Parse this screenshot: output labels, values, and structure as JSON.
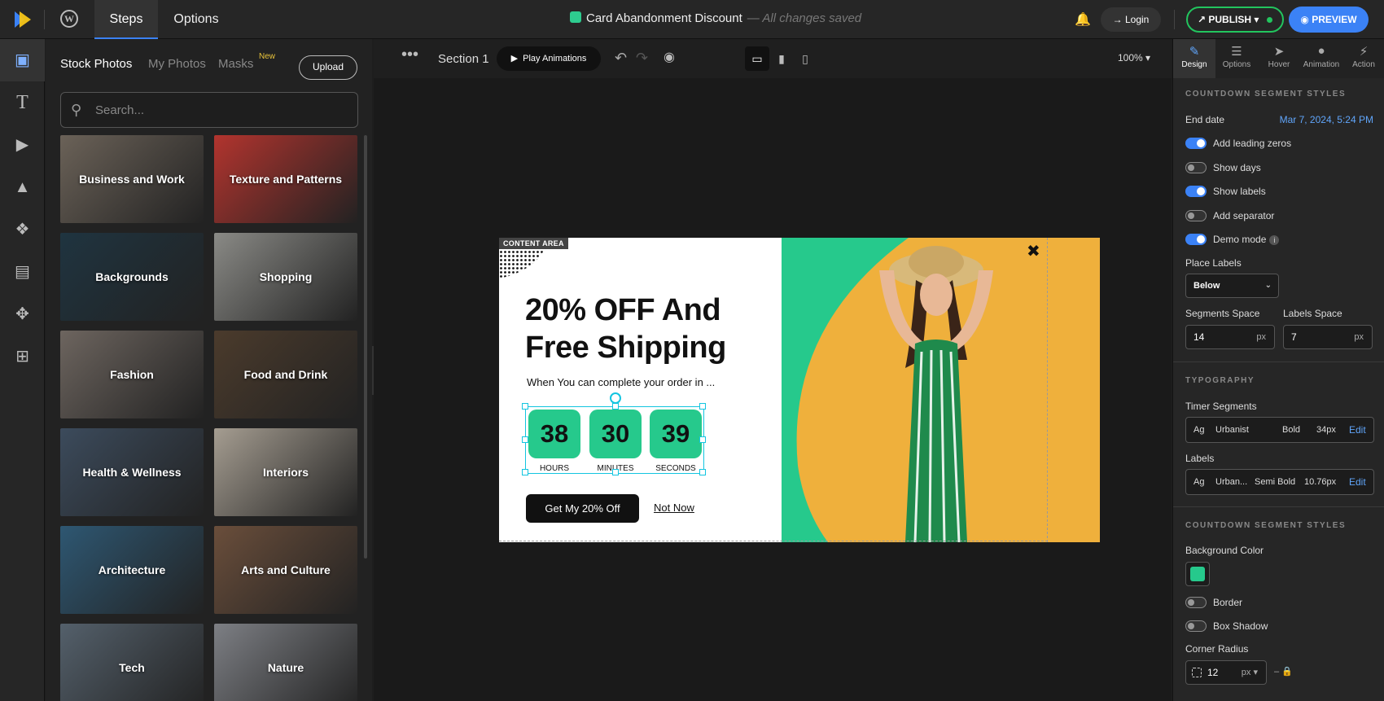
{
  "topbar": {
    "tabs": [
      "Steps",
      "Options"
    ],
    "title": "Card Abandonment Discount",
    "saved_status": "— All changes saved",
    "login_label": "Login",
    "publish_label": "PUBLISH",
    "preview_label": "PREVIEW"
  },
  "left_rail": {
    "icons": [
      "image-icon",
      "text-icon",
      "video-icon",
      "shapes-icon",
      "elements-icon",
      "form-icon",
      "move-icon",
      "add-icon"
    ]
  },
  "photos_panel": {
    "tabs": [
      "Stock Photos",
      "My Photos",
      "Masks"
    ],
    "masks_badge": "New",
    "upload_label": "Upload",
    "search_placeholder": "Search...",
    "categories": [
      {
        "label": "Business and Work",
        "color": "#6b6258"
      },
      {
        "label": "Texture and Patterns",
        "color": "#b2342e"
      },
      {
        "label": "Backgrounds",
        "color": "#1f3440"
      },
      {
        "label": "Shopping",
        "color": "#8a8a86"
      },
      {
        "label": "Fashion",
        "color": "#6d655f"
      },
      {
        "label": "Food and Drink",
        "color": "#4b3b2c"
      },
      {
        "label": "Health & Wellness",
        "color": "#3c4b5c"
      },
      {
        "label": "Interiors",
        "color": "#a59d91"
      },
      {
        "label": "Architecture",
        "color": "#2e5772"
      },
      {
        "label": "Arts and Culture",
        "color": "#6a4e3b"
      },
      {
        "label": "Tech",
        "color": "#54606b"
      },
      {
        "label": "Nature",
        "color": "#7d7f84"
      }
    ]
  },
  "canvas": {
    "section_label": "Section 1",
    "play_label": "Play Animations",
    "zoom": "100%",
    "popup": {
      "content_tag": "CONTENT AREA",
      "headline": "20% OFF And Free Shipping",
      "subline": "When You can complete your order in ...",
      "segments": [
        {
          "value": "38",
          "label": "HOURS"
        },
        {
          "value": "30",
          "label": "MINUTES"
        },
        {
          "value": "39",
          "label": "SECONDS"
        }
      ],
      "cta_label": "Get My  20% Off",
      "not_now_label": "Not Now",
      "accent_color": "#26c98c"
    }
  },
  "right_panel": {
    "tabs": [
      "Design",
      "Options",
      "Hover",
      "Animation",
      "Action"
    ],
    "countdown_title": "COUNTDOWN SEGMENT STYLES",
    "end_date_label": "End date",
    "end_date_value": "Mar 7, 2024, 5:24 PM",
    "toggles": [
      {
        "label": "Add leading zeros",
        "on": true
      },
      {
        "label": "Show days",
        "on": false
      },
      {
        "label": "Show labels",
        "on": true
      },
      {
        "label": "Add separator",
        "on": false
      },
      {
        "label": "Demo mode",
        "on": true
      }
    ],
    "place_labels_label": "Place Labels",
    "place_labels_value": "Below",
    "segments_space_label": "Segments Space",
    "segments_space_value": "14",
    "labels_space_label": "Labels Space",
    "labels_space_value": "7",
    "unit_px": "px",
    "typography_title": "TYPOGRAPHY",
    "timer_segments_label": "Timer Segments",
    "timer_font": {
      "ag": "Ag",
      "family": "Urbanist",
      "weight": "Bold",
      "size": "34px",
      "edit": "Edit"
    },
    "labels_label": "Labels",
    "labels_font": {
      "ag": "Ag",
      "family": "Urban...",
      "weight": "Semi Bold",
      "size": "10.76px",
      "edit": "Edit"
    },
    "style_title": "COUNTDOWN SEGMENT STYLES",
    "background_color_label": "Background Color",
    "border_label": "Border",
    "box_shadow_label": "Box Shadow",
    "corner_radius_label": "Corner Radius",
    "corner_radius_value": "12"
  }
}
